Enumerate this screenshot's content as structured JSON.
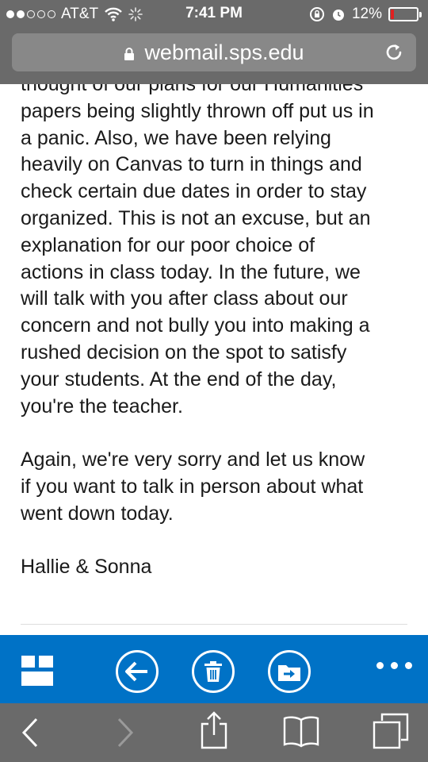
{
  "status_bar": {
    "carrier": "AT&T",
    "time": "7:41 PM",
    "battery_percent": "12%",
    "battery_level": 0.12,
    "battery_color": "#e02020",
    "icons": [
      "signal-dots-icon",
      "wifi-icon",
      "activity-spinner-icon",
      "orientation-lock-icon",
      "alarm-icon",
      "battery-icon"
    ]
  },
  "address_bar": {
    "url": "webmail.sps.edu",
    "icons": [
      "lock-icon",
      "reload-icon"
    ]
  },
  "email": {
    "partial_top_line": "thought of our plans for our Humanities",
    "paragraphs": [
      "papers being slightly thrown off put us in",
      "a panic. Also, we have been relying",
      "heavily on Canvas to turn in things and",
      "check certain due dates in order to stay",
      "organized. This is not an excuse, but an",
      "explanation for our poor choice of",
      "actions in class today. In the future, we",
      "will talk with you after class about our",
      "concern and not bully you into making a",
      "rushed decision on the spot to satisfy",
      "your students. At the end of the day,",
      "you're the teacher."
    ],
    "closing": [
      "Again, we're very sorry and let us know",
      "if you want to talk in person about what",
      "went down today."
    ],
    "signature": "Hallie & Sonna"
  },
  "owa_toolbar": {
    "background": "#0072c6",
    "buttons": [
      "folders-grid-icon",
      "reply-back-icon",
      "delete-trash-icon",
      "move-folder-icon",
      "more-options-icon"
    ]
  },
  "safari_toolbar": {
    "background": "#6a6a6a",
    "buttons": [
      "back-chevron-icon",
      "forward-chevron-icon",
      "share-icon",
      "bookmarks-book-icon",
      "tabs-icon"
    ]
  }
}
